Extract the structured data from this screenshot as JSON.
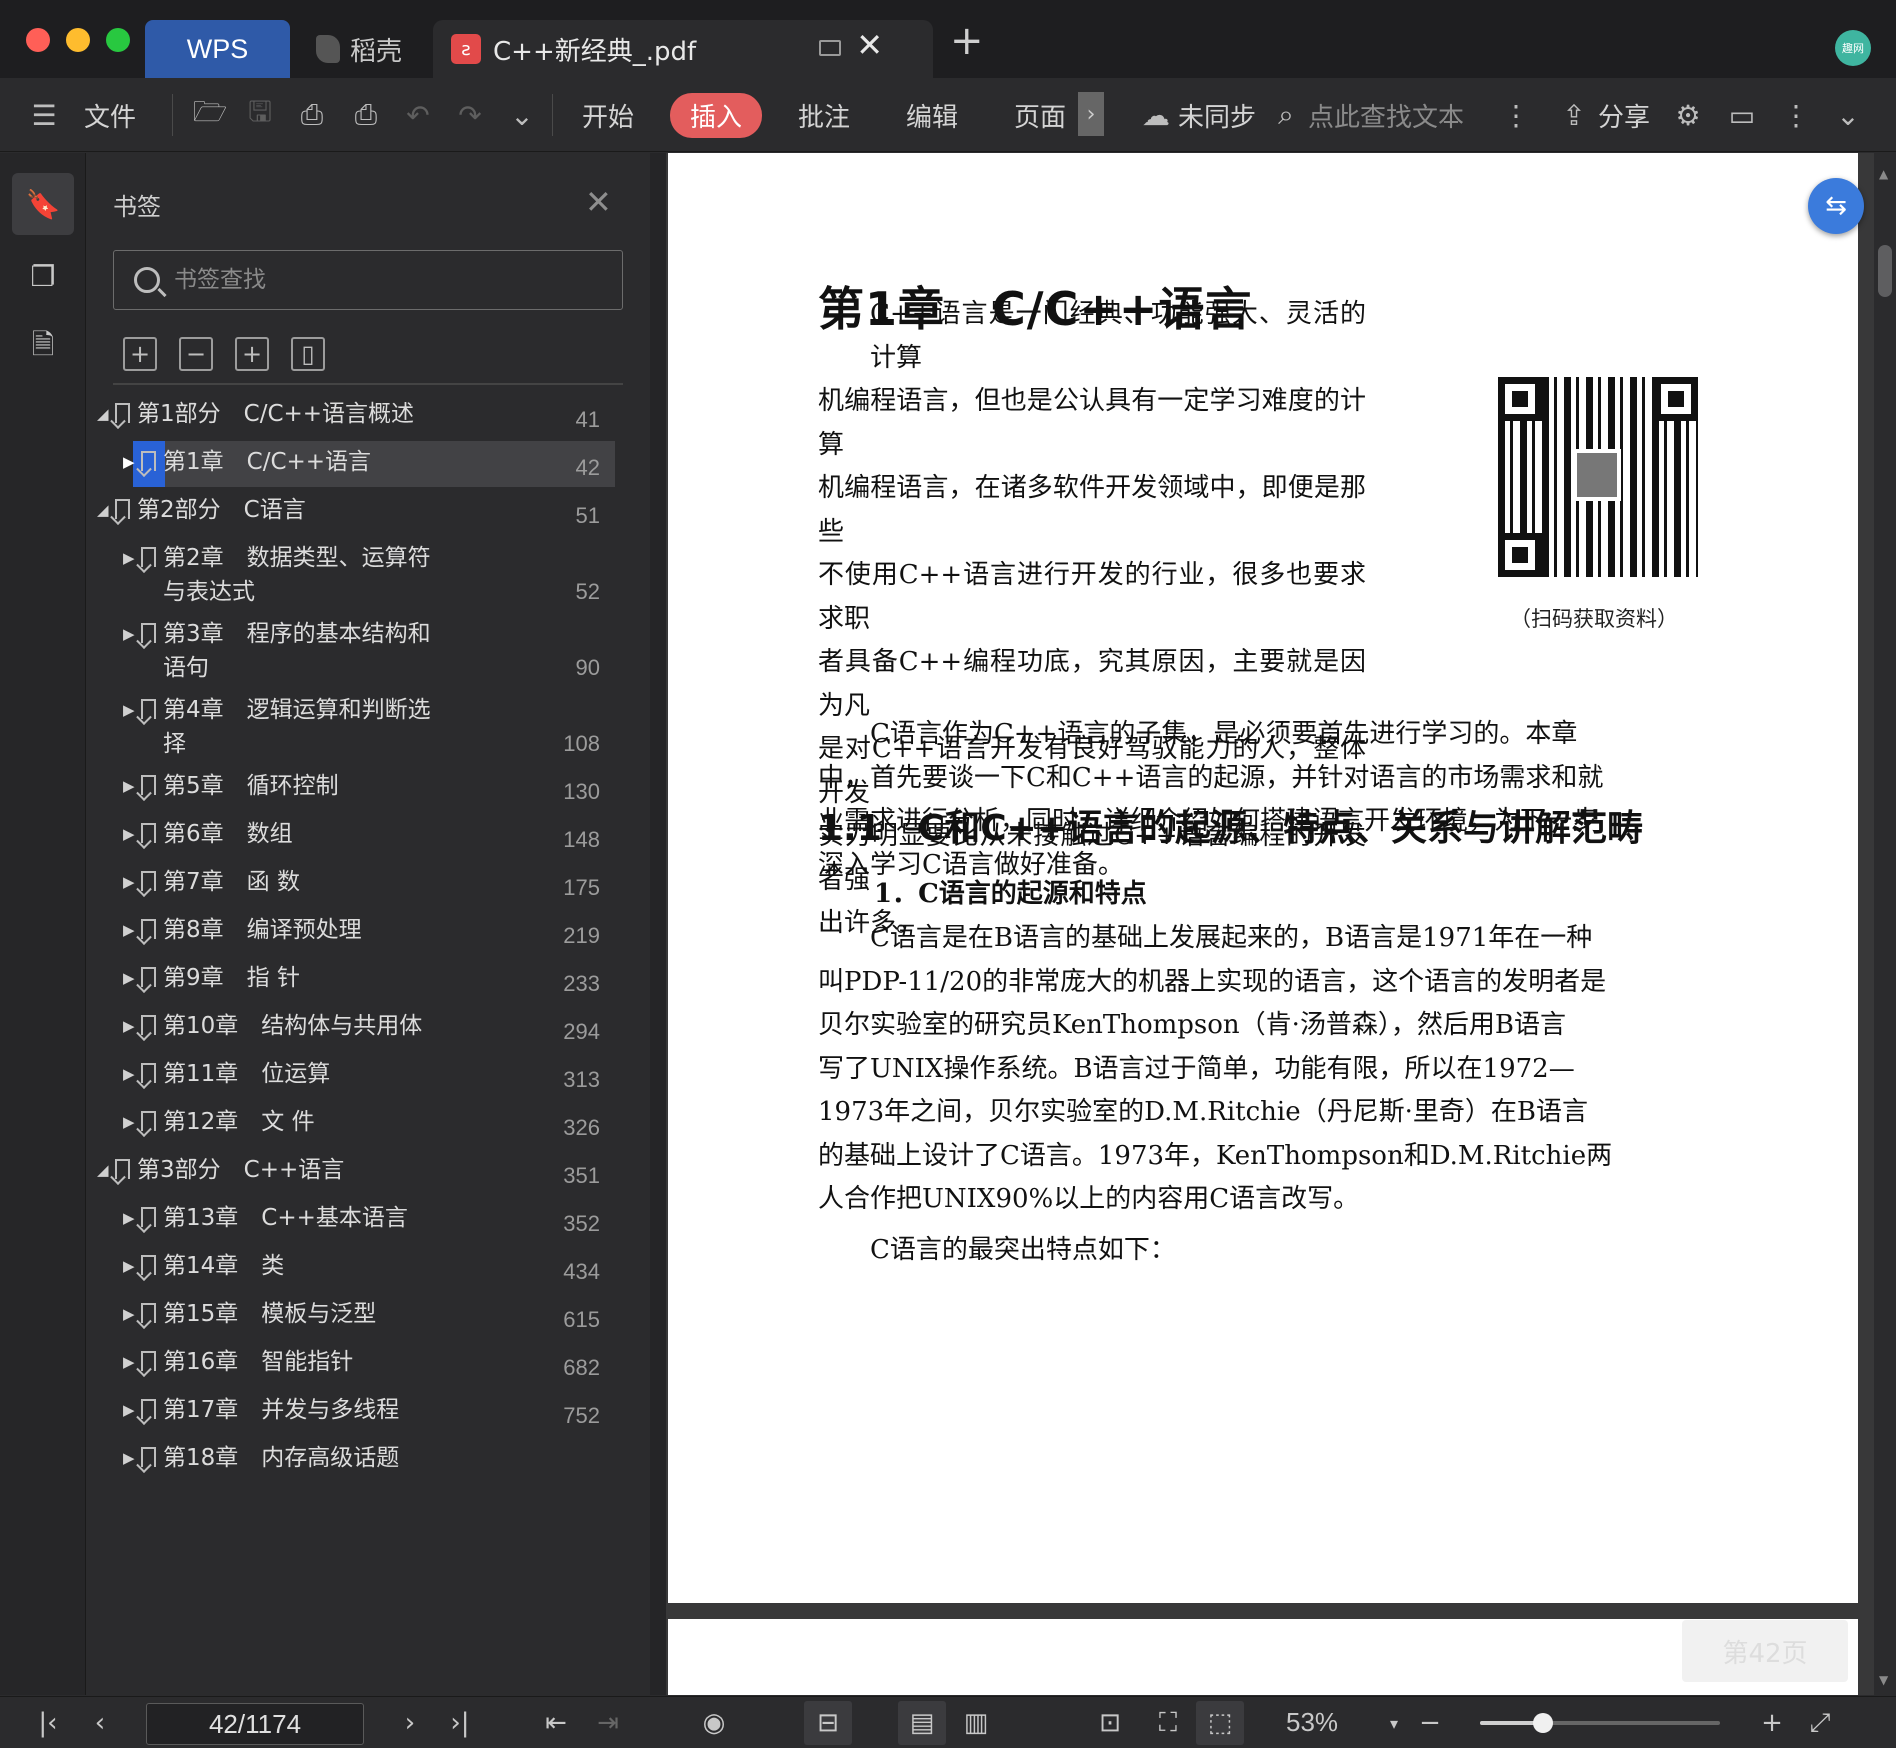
{
  "titlebar": {
    "tabs": [
      {
        "label": "WPS"
      },
      {
        "label": "稻壳"
      },
      {
        "label": "C++新经典_.pdf"
      }
    ],
    "avatar_text": "趣网"
  },
  "toolbar": {
    "menu": [
      {
        "label": "文件"
      },
      {
        "label": "开始"
      },
      {
        "label": "插入"
      },
      {
        "label": "批注"
      },
      {
        "label": "编辑"
      },
      {
        "label": "页面"
      }
    ],
    "sync_label": "未同步",
    "search_hint": "点此查找文本",
    "share_label": "分享",
    "accent_color": "#e35d5d"
  },
  "bookmarks": {
    "title": "书签",
    "search_placeholder": "书签查找",
    "items": [
      {
        "label": "第1部分　C/C++语言概述",
        "page": "41",
        "level": 0,
        "expanded": true
      },
      {
        "label": "第1章　C/C++语言",
        "page": "42",
        "level": 1,
        "selected": true
      },
      {
        "label": "第2部分　C语言",
        "page": "51",
        "level": 0,
        "expanded": true
      },
      {
        "label": "第2章　数据类型、运算符",
        "label2": "与表达式",
        "page": "52",
        "level": 1
      },
      {
        "label": "第3章　程序的基本结构和",
        "label2": "语句",
        "page": "90",
        "level": 1
      },
      {
        "label": "第4章　逻辑运算和判断选",
        "label2": "择",
        "page": "108",
        "level": 1
      },
      {
        "label": "第5章　循环控制",
        "page": "130",
        "level": 1
      },
      {
        "label": "第6章　数组",
        "page": "148",
        "level": 1
      },
      {
        "label": "第7章　函 数",
        "page": "175",
        "level": 1
      },
      {
        "label": "第8章　编译预处理",
        "page": "219",
        "level": 1
      },
      {
        "label": "第9章　指 针",
        "page": "233",
        "level": 1
      },
      {
        "label": "第10章　结构体与共用体",
        "page": "294",
        "level": 1
      },
      {
        "label": "第11章　位运算",
        "page": "313",
        "level": 1
      },
      {
        "label": "第12章　文 件",
        "page": "326",
        "level": 1
      },
      {
        "label": "第3部分　C++语言",
        "page": "351",
        "level": 0,
        "expanded": true
      },
      {
        "label": "第13章　C++基本语言",
        "page": "352",
        "level": 1
      },
      {
        "label": "第14章　类",
        "page": "434",
        "level": 1
      },
      {
        "label": "第15章　模板与泛型",
        "page": "615",
        "level": 1
      },
      {
        "label": "第16章　智能指针",
        "page": "682",
        "level": 1
      },
      {
        "label": "第17章　并发与多线程",
        "page": "752",
        "level": 1
      },
      {
        "label": "第18章　内存高级话题",
        "page": "",
        "level": 1
      }
    ]
  },
  "document": {
    "chapter_title": "第1章　C/C++语言",
    "intro_lines": [
      "C++语言是一门经典、功能强大、灵活的计算",
      "机编程语言，但也是公认具有一定学习难度的计算",
      "机编程语言，在诸多软件开发领域中，即便是那些",
      "不使用C++语言进行开发的行业，很多也要求求职",
      "者具备C++编程功底，究其原因，主要就是因为凡",
      "是对C++语言开发有良好驾驭能力的人，整体开发",
      "实力明显要比从未接触过C++语言编程的开发者强",
      "出许多。"
    ],
    "qr_caption": "（扫码获取资料）",
    "para2_lines": [
      "C语言作为C++语言的子集，是必须要首先进行学习的。本章",
      "中，首先要谈一下C和C++语言的起源，并针对语言的市场需求和就",
      "业需求进行分析，同时，详细介绍如何搭建语言开发环境，为下一步",
      "深入学习C语言做好准备。"
    ],
    "section_title": "1.1　C和C++语言的起源、特点、关系与讲解范畴",
    "subsection_title": "1．C语言的起源和特点",
    "para3_lines": [
      "C语言是在B语言的基础上发展起来的，B语言是1971年在一种",
      "叫PDP-11/20的非常庞大的机器上实现的语言，这个语言的发明者是",
      "贝尔实验室的研究员KenThompson（肯·汤普森），然后用B语言",
      "写了UNIX操作系统。B语言过于简单，功能有限，所以在1972—",
      "1973年之间，贝尔实验室的D.M.Ritchie（丹尼斯·里奇）在B语言",
      "的基础上设计了C语言。1973年，KenThompson和D.M.Ritchie两",
      "人合作把UNIX90%以上的内容用C语言改写。"
    ],
    "para4": "C语言的最突出特点如下：",
    "page_chip": "第42页"
  },
  "statusbar": {
    "page_value": "42/1174",
    "zoom_label": "53%",
    "zoom_level": 0.53
  }
}
